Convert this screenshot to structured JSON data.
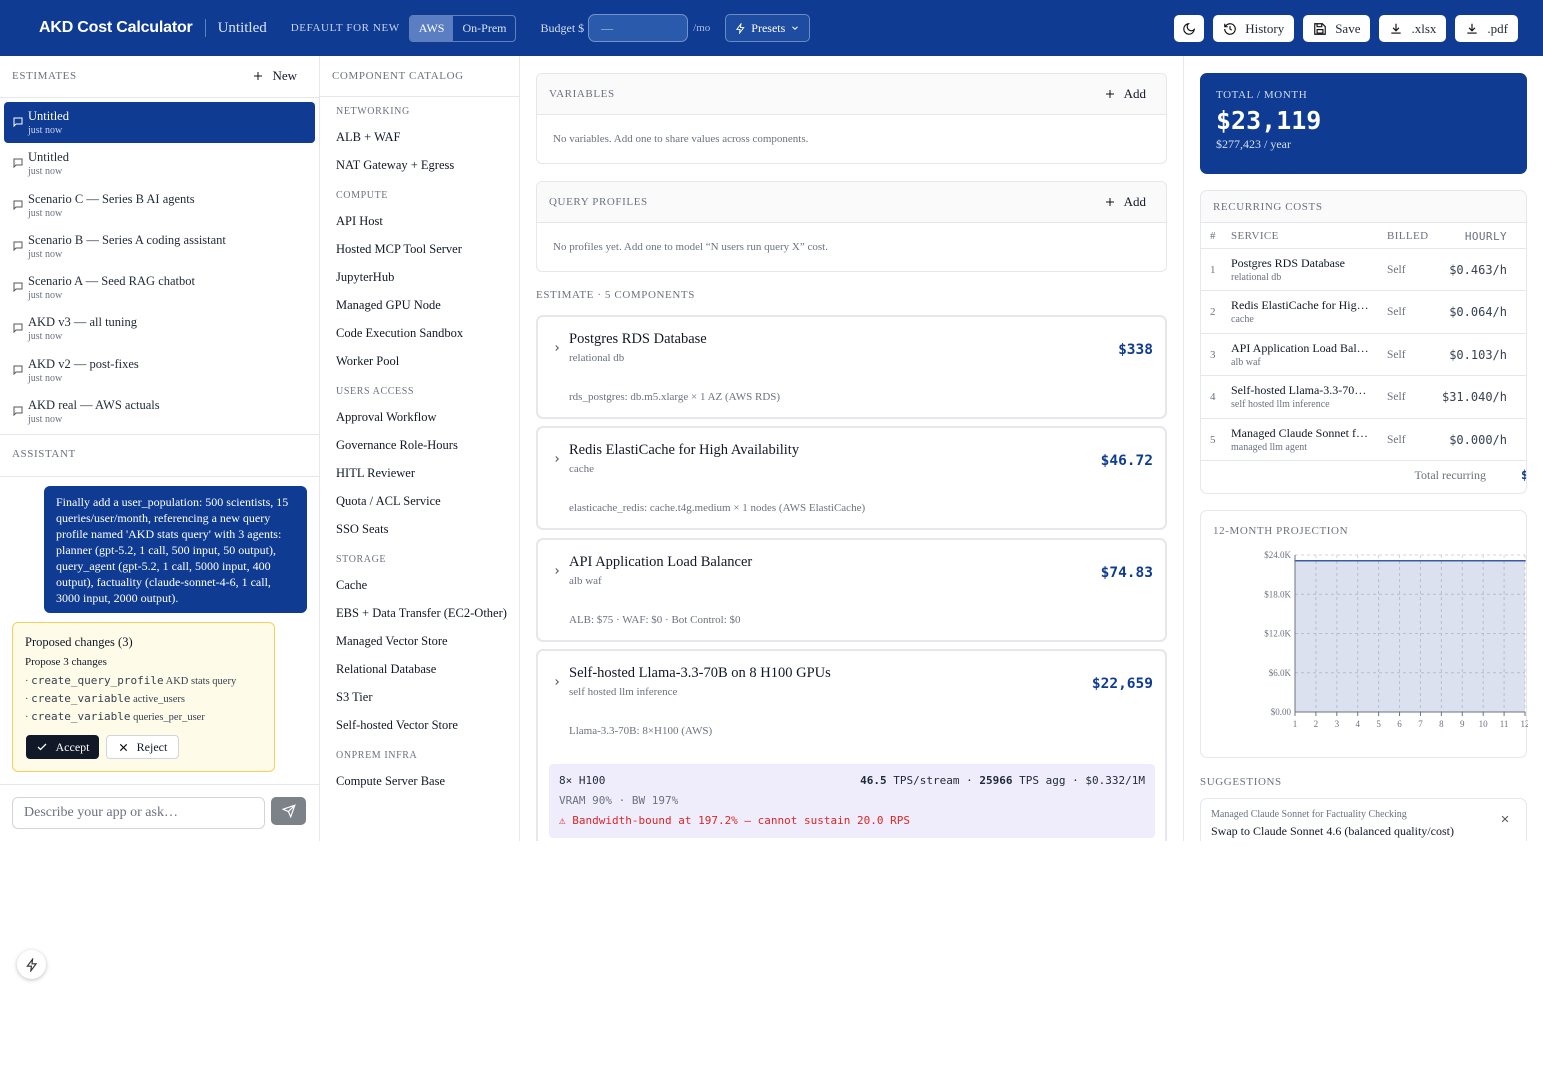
{
  "header": {
    "brand": "AKD Cost Calculator",
    "doc_title": "Untitled",
    "default_label": "DEFAULT FOR NEW",
    "env_options": [
      "AWS",
      "On-Prem"
    ],
    "env_selected": "AWS",
    "budget_label": "Budget $",
    "budget_placeholder": "—",
    "per_mo": "/mo",
    "presets_label": "Presets",
    "buttons": {
      "history": "History",
      "save": "Save",
      "xlsx": ".xlsx",
      "pdf": ".pdf"
    }
  },
  "estimates": {
    "title": "ESTIMATES",
    "new_label": "New",
    "items": [
      {
        "name": "Untitled",
        "time": "just now",
        "selected": true
      },
      {
        "name": "Untitled",
        "time": "just now"
      },
      {
        "name": "Scenario C — Series B AI agents",
        "time": "just now"
      },
      {
        "name": "Scenario B — Series A coding assistant",
        "time": "just now"
      },
      {
        "name": "Scenario A — Seed RAG chatbot",
        "time": "just now"
      },
      {
        "name": "AKD v3 — all tuning",
        "time": "just now"
      },
      {
        "name": "AKD v2 — post-fixes",
        "time": "just now"
      },
      {
        "name": "AKD real — AWS actuals",
        "time": "just now"
      }
    ]
  },
  "assistant": {
    "title": "ASSISTANT",
    "user_message": "Finally add a user_population: 500 scientists, 15 queries/user/month, referencing a new query profile named 'AKD stats query' with 3 agents: planner (gpt-5.2, 1 call, 500 input, 50 output), query_agent (gpt-5.2, 1 call, 5000 input, 400 output), factuality (claude-sonnet-4-6, 1 call, 3000 input, 2000 output).",
    "proposal": {
      "title": "Proposed changes (3)",
      "subtitle": "Propose 3 changes",
      "changes": [
        {
          "op": "create_query_profile",
          "target": "AKD stats query"
        },
        {
          "op": "create_variable",
          "target": "active_users"
        },
        {
          "op": "create_variable",
          "target": "queries_per_user"
        }
      ],
      "accept": "Accept",
      "reject": "Reject"
    },
    "input_placeholder": "Describe your app or ask…"
  },
  "catalog": {
    "title": "COMPONENT CATALOG",
    "groups": [
      {
        "name": "NETWORKING",
        "items": [
          "ALB + WAF",
          "NAT Gateway + Egress"
        ]
      },
      {
        "name": "COMPUTE",
        "items": [
          "API Host",
          "Hosted MCP Tool Server",
          "JupyterHub",
          "Managed GPU Node",
          "Code Execution Sandbox",
          "Worker Pool"
        ]
      },
      {
        "name": "USERS ACCESS",
        "items": [
          "Approval Workflow",
          "Governance Role-Hours",
          "HITL Reviewer",
          "Quota / ACL Service",
          "SSO Seats"
        ]
      },
      {
        "name": "STORAGE",
        "items": [
          "Cache",
          "EBS + Data Transfer (EC2-Other)",
          "Managed Vector Store",
          "Relational Database",
          "S3 Tier",
          "Self-hosted Vector Store"
        ]
      },
      {
        "name": "ONPREM INFRA",
        "items": [
          "Compute Server Base"
        ]
      }
    ]
  },
  "main": {
    "variables": {
      "title": "VARIABLES",
      "add": "Add",
      "empty": "No variables. Add one to share values across components."
    },
    "profiles": {
      "title": "QUERY PROFILES",
      "add": "Add",
      "empty": "No profiles yet. Add one to model “N users run query X” cost."
    },
    "estimate_title": "ESTIMATE · 5 COMPONENTS",
    "components": [
      {
        "name": "Postgres RDS Database",
        "sub": "relational db",
        "price": "$338",
        "detail": "rds_postgres: db.m5.xlarge × 1 AZ (AWS RDS)"
      },
      {
        "name": "Redis ElastiCache for High Availability",
        "sub": "cache",
        "price": "$46.72",
        "detail": "elasticache_redis: cache.t4g.medium × 1 nodes (AWS ElastiCache)"
      },
      {
        "name": "API Application Load Balancer",
        "sub": "alb waf",
        "price": "$74.83",
        "detail": "ALB: $75 · WAF: $0 · Bot Control: $0"
      },
      {
        "name": "Self-hosted Llama-3.3-70B on 8 H100 GPUs",
        "sub": "self hosted llm inference",
        "price": "$22,659",
        "detail": "Llama-3.3-70B: 8×H100 (AWS)"
      }
    ],
    "gpu": {
      "gpu": "8× H100",
      "tps_stream": "46.5",
      "tps_stream_label": "TPS/stream ·",
      "tps_agg": "25966",
      "tps_agg_label": "TPS agg · $0.332/1M",
      "util": "VRAM 90% · BW 197%",
      "warning": "⚠ Bandwidth-bound at 197.2% — cannot sustain 20.0 RPS"
    }
  },
  "summary": {
    "total_label": "TOTAL / MONTH",
    "total": "$23,119",
    "yearly": "$277,423 / year",
    "recurring": {
      "title": "RECURRING COSTS",
      "headers": [
        "#",
        "SERVICE",
        "BILLED",
        "HOURLY"
      ],
      "rows": [
        {
          "n": "1",
          "service": "Postgres RDS Database",
          "sub": "relational db",
          "billed": "Self",
          "hourly": "$0.463/h"
        },
        {
          "n": "2",
          "service": "Redis ElastiCache for High Availability",
          "sub": "cache",
          "billed": "Self",
          "hourly": "$0.064/h"
        },
        {
          "n": "3",
          "service": "API Application Load Balancer",
          "sub": "alb waf",
          "billed": "Self",
          "hourly": "$0.103/h"
        },
        {
          "n": "4",
          "service": "Self-hosted Llama-3.3-70B on 8 H100 GPUs",
          "sub": "self hosted llm inference",
          "billed": "Self",
          "hourly": "$31.040/h"
        },
        {
          "n": "5",
          "service": "Managed Claude Sonnet for Factuality Checking",
          "sub": "managed llm agent",
          "billed": "Self",
          "hourly": "$0.000/h"
        }
      ],
      "total_label": "Total recurring",
      "total_value": "$"
    },
    "projection_title": "12-MONTH PROJECTION",
    "suggestions_title": "SUGGESTIONS",
    "suggestion": {
      "context": "Managed Claude Sonnet for Factuality Checking",
      "text": "Swap to Claude Sonnet 4.6 (balanced quality/cost)"
    }
  },
  "chart_data": {
    "type": "area",
    "title": "12-MONTH PROJECTION",
    "x": [
      1,
      2,
      3,
      4,
      5,
      6,
      7,
      8,
      9,
      10,
      11,
      12
    ],
    "values": [
      23119,
      23119,
      23119,
      23119,
      23119,
      23119,
      23119,
      23119,
      23119,
      23119,
      23119,
      23119
    ],
    "yticks": [
      "$0.00",
      "$6.0K",
      "$12.0K",
      "$18.0K",
      "$24.0K"
    ],
    "ylim": [
      0,
      24000
    ],
    "grid": true,
    "series_color": "#3b5aa8"
  },
  "colors": {
    "brand": "#0f3c92",
    "warning": "#dc2626",
    "proposal_bg": "#fefbe8"
  }
}
